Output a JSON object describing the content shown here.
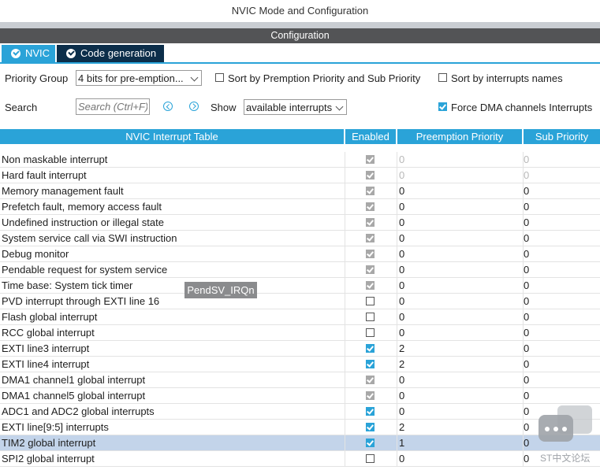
{
  "window": {
    "title": "NVIC Mode and Configuration"
  },
  "config_bar": {
    "label": "Configuration"
  },
  "tabs": [
    {
      "label": "NVIC",
      "active": true
    },
    {
      "label": "Code generation",
      "active": false
    }
  ],
  "toolbar": {
    "priority_group_label": "Priority Group",
    "priority_group_value": "4 bits for pre-emption...",
    "sort_premption_label": "Sort by Premption Priority and Sub Priority",
    "sort_premption_checked": false,
    "sort_names_label": "Sort by interrupts names",
    "sort_names_checked": false,
    "search_label": "Search",
    "search_placeholder": "Search (Ctrl+F)",
    "show_label": "Show",
    "show_value": "available interrupts",
    "force_dma_label": "Force DMA channels Interrupts",
    "force_dma_checked": true
  },
  "table": {
    "headers": [
      "NVIC Interrupt Table",
      "Enabled",
      "Preemption Priority",
      "Sub Priority"
    ],
    "rows": [
      {
        "name": "Non maskable interrupt",
        "enabled": "locked",
        "preemption": "0",
        "sub": "0",
        "dim": true
      },
      {
        "name": "Hard fault interrupt",
        "enabled": "locked",
        "preemption": "0",
        "sub": "0",
        "dim": true
      },
      {
        "name": "Memory management fault",
        "enabled": "locked",
        "preemption": "0",
        "sub": "0",
        "dim": false
      },
      {
        "name": "Prefetch fault, memory access fault",
        "enabled": "locked",
        "preemption": "0",
        "sub": "0",
        "dim": false
      },
      {
        "name": "Undefined instruction or illegal state",
        "enabled": "locked",
        "preemption": "0",
        "sub": "0",
        "dim": false
      },
      {
        "name": "System service call via SWI instruction",
        "enabled": "locked",
        "preemption": "0",
        "sub": "0",
        "dim": false
      },
      {
        "name": "Debug monitor",
        "enabled": "locked",
        "preemption": "0",
        "sub": "0",
        "dim": false
      },
      {
        "name": "Pendable request for system service",
        "enabled": "locked",
        "preemption": "0",
        "sub": "0",
        "dim": false
      },
      {
        "name": "Time base: System tick timer",
        "enabled": "locked",
        "preemption": "0",
        "sub": "0",
        "dim": false
      },
      {
        "name": "PVD interrupt through EXTI line 16",
        "enabled": "off",
        "preemption": "0",
        "sub": "0",
        "dim": false
      },
      {
        "name": "Flash global interrupt",
        "enabled": "off",
        "preemption": "0",
        "sub": "0",
        "dim": false
      },
      {
        "name": "RCC global interrupt",
        "enabled": "off",
        "preemption": "0",
        "sub": "0",
        "dim": false
      },
      {
        "name": "EXTI line3 interrupt",
        "enabled": "on",
        "preemption": "2",
        "sub": "0",
        "dim": false
      },
      {
        "name": "EXTI line4 interrupt",
        "enabled": "on",
        "preemption": "2",
        "sub": "0",
        "dim": false
      },
      {
        "name": "DMA1 channel1 global interrupt",
        "enabled": "locked",
        "preemption": "0",
        "sub": "0",
        "dim": false
      },
      {
        "name": "DMA1 channel5 global interrupt",
        "enabled": "locked",
        "preemption": "0",
        "sub": "0",
        "dim": false
      },
      {
        "name": "ADC1 and ADC2 global interrupts",
        "enabled": "on",
        "preemption": "0",
        "sub": "0",
        "dim": false
      },
      {
        "name": "EXTI line[9:5] interrupts",
        "enabled": "on",
        "preemption": "2",
        "sub": "0",
        "dim": false
      },
      {
        "name": "TIM2 global interrupt",
        "enabled": "on",
        "preemption": "1",
        "sub": "0",
        "dim": false,
        "selected": true
      },
      {
        "name": "SPI2 global interrupt",
        "enabled": "off",
        "preemption": "0",
        "sub": "0",
        "dim": false
      }
    ]
  },
  "tooltip": {
    "text": "PendSV_IRQn"
  },
  "watermark": {
    "text": "ST中文论坛"
  },
  "colors": {
    "accent": "#2aa3d8",
    "dark_tab": "#0c2e4a",
    "selected_row": "#c3d4ea",
    "header_bar": "#535456"
  }
}
